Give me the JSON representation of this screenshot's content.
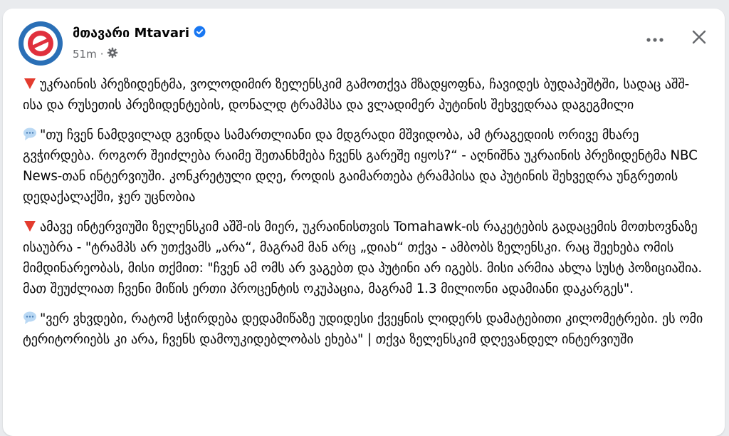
{
  "post": {
    "page_name": "მთავარი Mtavari",
    "time": "51m",
    "separator": "·",
    "colors": {
      "brand_blue": "#2a6fb6",
      "brand_red": "#e0303d",
      "verified_blue": "#1877f2",
      "red_triangle": "#e33b2e",
      "speech_bubble": "#b9d8f4"
    },
    "icons": {
      "avatar": "mtavari-logo",
      "verified": "verified-badge-icon",
      "audience": "gear-icon",
      "more": "more-options-icon",
      "close": "close-icon"
    },
    "paragraphs": [
      {
        "emoji": "red-triangle-down",
        "text": "უკრაინის პრეზიდენტმა, ვოლოდიმირ ზელენსკიმ გამოთქვა მზადყოფნა, ჩავიდეს ბუდაპეშტში, სადაც აშშ-ისა და რუსეთის პრეზიდენტების, დონალდ ტრამპსა და ვლადიმერ პუტინის შეხვედრაა დაგეგმილი"
      },
      {
        "emoji": "speech-balloon",
        "text": "\"თუ ჩვენ ნამდვილად გვინდა სამართლიანი და მდგრადი მშვიდობა, ამ ტრაგედიის ორივე მხარე გვჭირდება. როგორ შეიძლება რაიმე შეთანხმება ჩვენს გარეშე იყოს?“ - აღნიშნა უკრაინის პრეზიდენტმა NBC News-თან ინტერვიუში. კონკრეტული დღე, როდის გაიმართება ტრამპისა და პუტინის შეხვედრა უნგრეთის დედაქალაქში, ჯერ უცნობია"
      },
      {
        "emoji": "red-triangle-down",
        "text": "ამავე ინტერვიუში ზელენსკიმ აშშ-ის მიერ, უკრაინისთვის Tomahawk-ის რაკეტების გადაცემის მოთხოვნაზე ისაუბრა - \"ტრამპს არ უთქვამს „არა“, მაგრამ მან არც „დიახ“ თქვა - ამბობს ზელენსკი. რაც შეეხება ომის მიმდინარეობას, მისი თქმით: \"ჩვენ ამ ომს არ ვაგებთ და პუტინი არ იგებს. მისი არმია ახლა სუსტ პოზიციაშია. მათ შეუძლიათ ჩვენი მიწის ერთი პროცენტის ოკუპაცია, მაგრამ 1.3 მილიონი ადამიანი დაკარგეს\"."
      },
      {
        "emoji": "speech-balloon",
        "text": "\"ვერ ვხვდები, რატომ სჭირდება დედამიწაზე უდიდესი ქვეყნის ლიდერს დამატებითი კილომეტრები. ეს ომი ტერიტორიებს კი არა, ჩვენს დამოუკიდებლობას ეხება\" | თქვა ზელენსკიმ დღევანდელ ინტერვიუში"
      }
    ]
  }
}
